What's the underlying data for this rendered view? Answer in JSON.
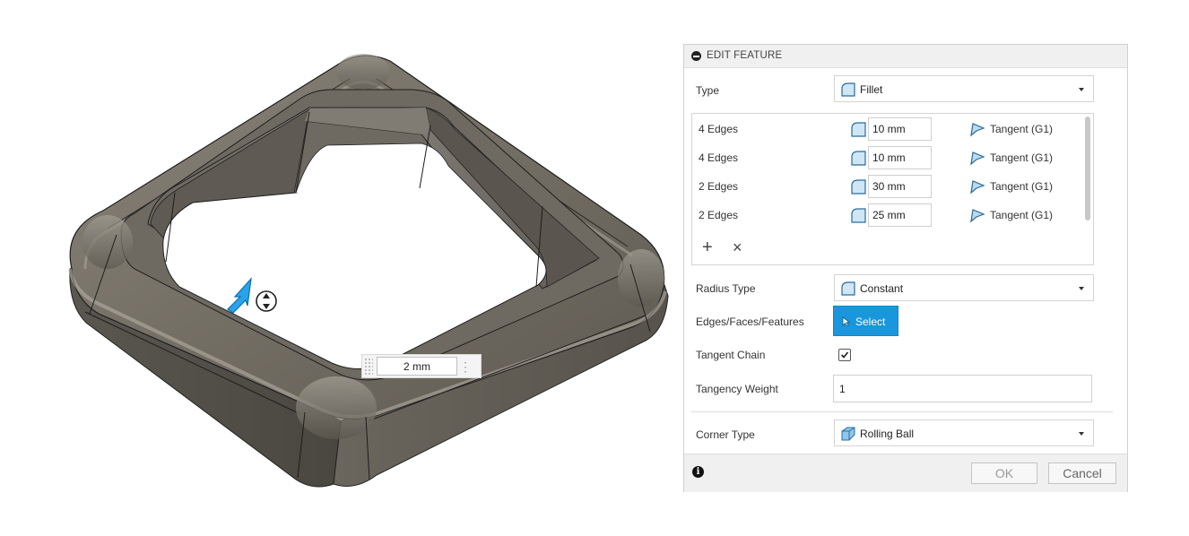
{
  "canvas": {
    "dimension_value": "2 mm",
    "dimension_menu_icon": "more-vertical-icon",
    "handle_icons": [
      "drag-arrow-icon",
      "flip-direction-icon"
    ],
    "model_color": "#6f6a60"
  },
  "dialog": {
    "title": "EDIT FEATURE",
    "type": {
      "label": "Type",
      "value": "Fillet",
      "icon": "fillet-icon"
    },
    "edges": [
      {
        "label": "4 Edges",
        "radius": "10 mm",
        "continuity": "Tangent (G1)"
      },
      {
        "label": "4 Edges",
        "radius": "10 mm",
        "continuity": "Tangent (G1)"
      },
      {
        "label": "2 Edges",
        "radius": "30 mm",
        "continuity": "Tangent (G1)"
      },
      {
        "label": "2 Edges",
        "radius": "25 mm",
        "continuity": "Tangent (G1)"
      }
    ],
    "add_icon": "plus-icon",
    "remove_icon": "close-icon",
    "radius_type": {
      "label": "Radius Type",
      "value": "Constant",
      "icon": "constant-radius-icon"
    },
    "selection": {
      "label": "Edges/Faces/Features",
      "button": "Select",
      "icon": "cursor-icon",
      "color": "#1a96dc"
    },
    "tangent_chain": {
      "label": "Tangent Chain",
      "checked": true
    },
    "tangency_weight": {
      "label": "Tangency Weight",
      "value": "1"
    },
    "corner_type": {
      "label": "Corner Type",
      "value": "Rolling Ball",
      "icon": "rolling-ball-icon"
    },
    "footer": {
      "info_icon": "info-icon",
      "ok": "OK",
      "cancel": "Cancel"
    }
  }
}
